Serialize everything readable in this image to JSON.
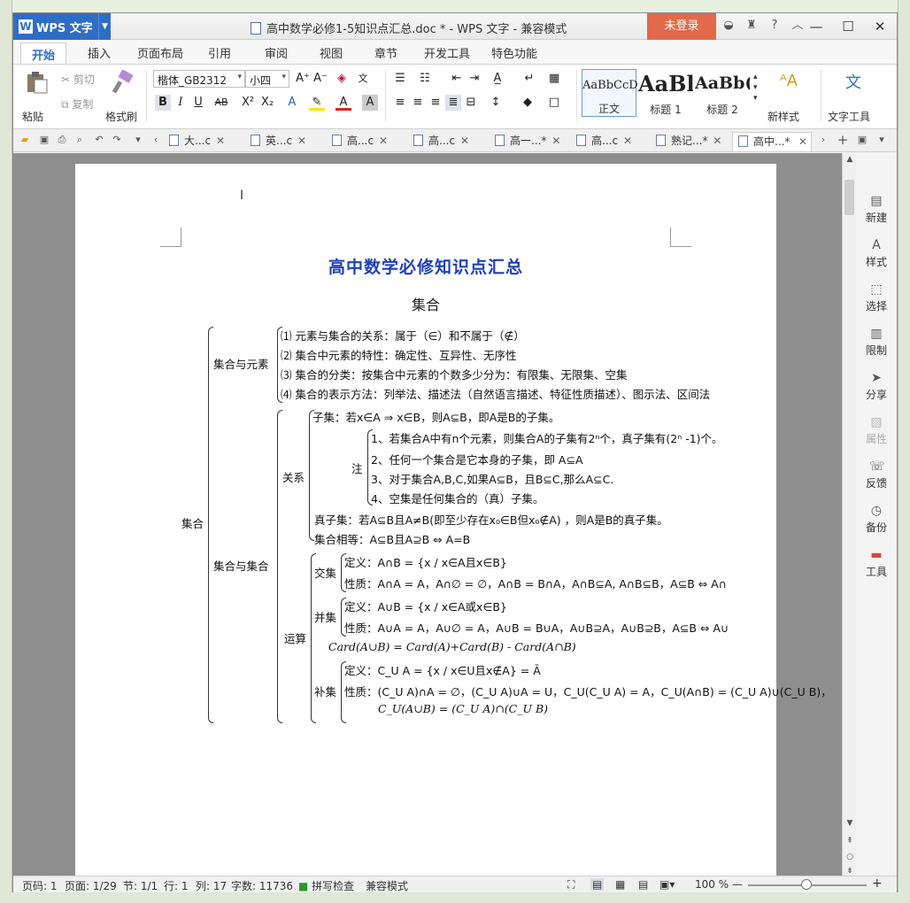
{
  "window": {
    "app_name": "WPS 文字",
    "title": "高中数学必修1-5知识点汇总.doc * - WPS 文字 - 兼容模式",
    "login": "未登录"
  },
  "menu": {
    "tabs": [
      "开始",
      "插入",
      "页面布局",
      "引用",
      "审阅",
      "视图",
      "章节",
      "开发工具",
      "特色功能"
    ]
  },
  "ribbon": {
    "paste": "粘贴",
    "cut": "剪切",
    "copy": "复制",
    "format_painter": "格式刷",
    "font_name": "楷体_GB2312",
    "font_size": "小四",
    "styles": [
      {
        "sample": "AaBbCcD",
        "label": "正文"
      },
      {
        "sample": "AaBl",
        "label": "标题 1"
      },
      {
        "sample": "AaBb(",
        "label": "标题 2"
      }
    ],
    "new_style": "新样式",
    "text_tools": "文字工具"
  },
  "doc_tabs": [
    "大...c",
    "英...c",
    "高...c",
    "高...c",
    "高一...*",
    "高...c",
    "熟记...*",
    "高中...*"
  ],
  "document": {
    "title": "高中数学必修知识点汇总",
    "subtitle": "集合",
    "root": "集合",
    "group1": "集合与元素",
    "items1": [
      "⑴ 元素与集合的关系：属于（∈）和不属于（∉）",
      "⑵ 集合中元素的特性：确定性、互异性、无序性",
      "⑶ 集合的分类：按集合中元素的个数多少分为：有限集、无限集、空集",
      "⑷ 集合的表示方法：列举法、描述法（自然语言描述、特征性质描述）、图示法、区间法"
    ],
    "group2": "集合与集合",
    "relation": "关系",
    "subset": "子集：若x∈A ⇒ x∈B，则A⊆B，即A是B的子集。",
    "note": "注",
    "notes": [
      "1、若集合A中有n个元素，则集合A的子集有2ⁿ个，真子集有(2ⁿ -1)个。",
      "2、任何一个集合是它本身的子集，即 A⊆A",
      "3、对于集合A,B,C,如果A⊆B，且B⊆C,那么A⊆C.",
      "4、空集是任何集合的（真）子集。"
    ],
    "proper_subset": "真子集：若A⊆B且A≠B(即至少存在x₀∈B但x₀∉A) ，则A是B的真子集。",
    "equality": "集合相等：A⊆B且A⊇B   ⇔ A=B",
    "operation": "运算",
    "intersection": "交集",
    "inter_def": "定义：A∩B = {x / x∈A且x∈B}",
    "inter_prop": "性质：A∩A = A，A∩∅ = ∅，A∩B = B∩A，A∩B⊆A, A∩B⊆B，A⊆B ⇔ A∩",
    "union": "并集",
    "union_def": "定义：A∪B = {x / x∈A或x∈B}",
    "union_prop": "性质：A∪A = A，A∪∅ = A，A∪B = B∪A，A∪B⊇A，A∪B⊇B，A⊆B ⇔ A∪",
    "card": "Card(A∪B) = Card(A)+Card(B) - Card(A∩B)",
    "complement": "补集",
    "comp_def": "定义：C_U A = {x / x∈U且x∉A} = Ā",
    "comp_prop1": "性质：(C_U A)∩A = ∅，(C_U A)∪A = U，C_U(C_U A) = A，C_U(A∩B) = (C_U A)∪(C_U B)，",
    "comp_prop2": "C_U(A∪B) = (C_U A)∩(C_U B)"
  },
  "side_panel": [
    "新建",
    "样式",
    "选择",
    "限制",
    "分享",
    "属性",
    "反馈",
    "备份",
    "工具"
  ],
  "status": {
    "page_num": "页码: 1",
    "pages": "页面: 1/29",
    "section": "节: 1/1",
    "row": "行: 1",
    "col": "列: 17",
    "words": "字数: 11736",
    "spell": "拼写检查",
    "compat": "兼容模式",
    "zoom": "100 %"
  },
  "colors": {
    "accent": "#2e6dc6",
    "login": "#e26a4a",
    "title_blue": "#1f3fbf"
  }
}
